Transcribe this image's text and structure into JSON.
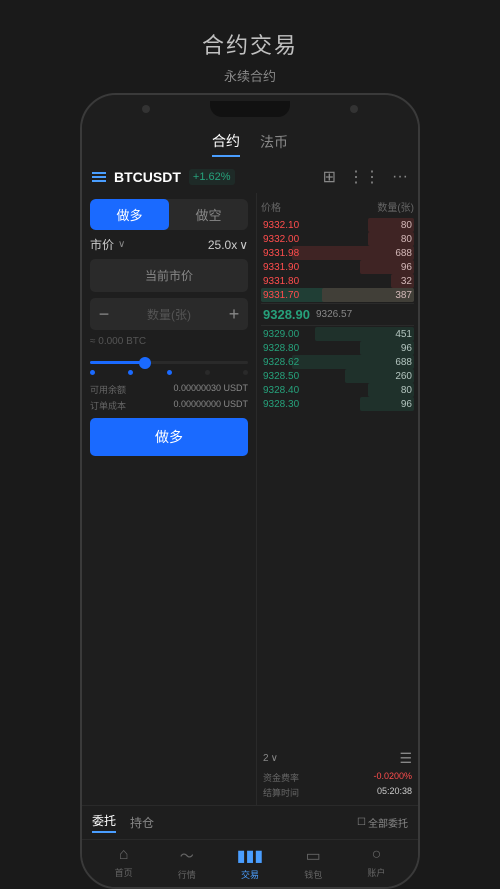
{
  "page": {
    "title": "合约交易",
    "subtitle": "永续合约"
  },
  "phone": {
    "topNav": {
      "items": [
        {
          "label": "合约",
          "active": true
        },
        {
          "label": "法币",
          "active": false
        }
      ]
    },
    "instrument": {
      "name": "BTCUSDT",
      "change": "+1.62%",
      "changePositive": true
    },
    "leftPanel": {
      "buyTab": "做多",
      "sellTab": "做空",
      "orderType": "市价",
      "leverage": "25.0x",
      "priceLabel": "当前市价",
      "qtyMinus": "−",
      "qtyPlaceholder": "数量(张)",
      "qtyPlus": "+",
      "approxBtc": "≈ 0.000 BTC",
      "balanceLabel": "可用余额",
      "balanceValue": "0.00000030 USDT",
      "costLabel": "订单成本",
      "costValue": "0.00000000 USDT",
      "buyButtonLabel": "做多"
    },
    "orderBook": {
      "headers": {
        "price": "价格",
        "qty": "数量(张)"
      },
      "sells": [
        {
          "price": "9332.10",
          "qty": "80",
          "barWidth": "30%"
        },
        {
          "price": "9332.00",
          "qty": "80",
          "barWidth": "30%"
        },
        {
          "price": "9331.98",
          "qty": "688",
          "barWidth": "80%"
        },
        {
          "price": "9331.90",
          "qty": "96",
          "barWidth": "35%"
        },
        {
          "price": "9331.80",
          "qty": "32",
          "barWidth": "15%"
        },
        {
          "price": "9331.70",
          "qty": "387",
          "barWidth": "60%",
          "highlight": true
        }
      ],
      "midPrice": "9328.90",
      "midPriceSecondary": "9326.57",
      "buys": [
        {
          "price": "9329.00",
          "qty": "451",
          "barWidth": "65%"
        },
        {
          "price": "9328.80",
          "qty": "96",
          "barWidth": "35%"
        },
        {
          "price": "9328.62",
          "qty": "688",
          "barWidth": "80%"
        },
        {
          "price": "9328.50",
          "qty": "260",
          "barWidth": "45%"
        },
        {
          "price": "9328.40",
          "qty": "80",
          "barWidth": "30%"
        },
        {
          "price": "9328.30",
          "qty": "96",
          "barWidth": "35%"
        }
      ],
      "dropdownValue": "2",
      "fundingRate": "-0.0200%",
      "settlementTime": "05:20:38",
      "fundingRateLabel": "资金费率",
      "settlementLabel": "结算时间"
    },
    "ordersSection": {
      "tabs": [
        {
          "label": "委托",
          "active": true
        },
        {
          "label": "持仓",
          "active": false
        }
      ],
      "allOrdersLabel": "全部委托"
    },
    "bottomNav": {
      "items": [
        {
          "label": "首页",
          "icon": "⌂",
          "active": false
        },
        {
          "label": "行情",
          "icon": "📈",
          "active": false
        },
        {
          "label": "交易",
          "icon": "📊",
          "active": true
        },
        {
          "label": "钱包",
          "icon": "👛",
          "active": false
        },
        {
          "label": "账户",
          "icon": "👤",
          "active": false
        }
      ]
    }
  },
  "outerBottomNav": {
    "items": [
      {
        "label": "首页",
        "active": false
      },
      {
        "label": "行情",
        "active": false
      },
      {
        "label": "交易",
        "active": true
      },
      {
        "label": "钱包",
        "active": false
      },
      {
        "label": "账户",
        "active": false
      }
    ]
  }
}
